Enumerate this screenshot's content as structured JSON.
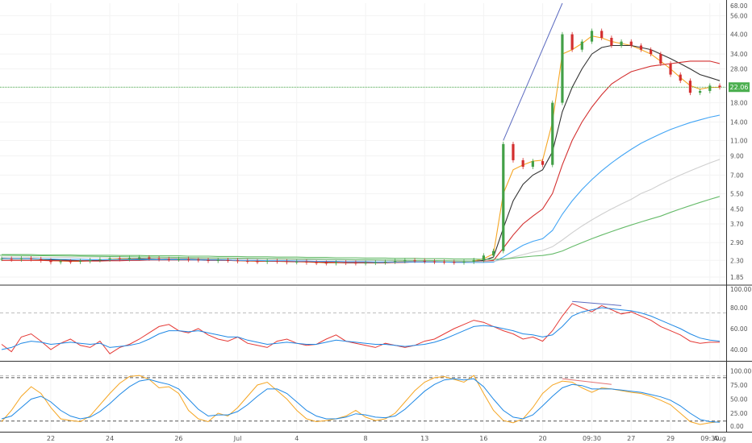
{
  "chart_data": [
    {
      "type": "candlestick",
      "panel": "price",
      "scale": "log",
      "ylim": [
        1.7,
        66
      ],
      "y_ticks": [
        "68.00",
        "56.00",
        "44.00",
        "34.00",
        "28.00",
        "22.00",
        "18.00",
        "14.00",
        "11.00",
        "9.00",
        "7.00",
        "5.50",
        "4.50",
        "3.70",
        "2.90",
        "2.30",
        "1.85"
      ],
      "last_price_label": "22.06",
      "last_price": 22.06,
      "x_ticks": [
        "22",
        "24",
        "26",
        "Jul",
        "4",
        "8",
        "13",
        "16",
        "20",
        "09:30",
        "27",
        "29",
        "09:30",
        "Aug"
      ],
      "closes": [
        2.35,
        2.33,
        2.36,
        2.34,
        2.3,
        2.25,
        2.27,
        2.26,
        2.28,
        2.31,
        2.33,
        2.36,
        2.34,
        2.37,
        2.39,
        2.36,
        2.34,
        2.33,
        2.34,
        2.32,
        2.31,
        2.29,
        2.31,
        2.3,
        2.28,
        2.27,
        2.26,
        2.28,
        2.27,
        2.25,
        2.26,
        2.24,
        2.23,
        2.22,
        2.24,
        2.23,
        2.22,
        2.23,
        2.24,
        2.26,
        2.28,
        2.3,
        2.29,
        2.27,
        2.26,
        2.25,
        2.24,
        2.26,
        2.31,
        2.45,
        2.6,
        10.5,
        8.5,
        7.8,
        8.4,
        8.0,
        18.0,
        44.0,
        36.0,
        40.0,
        46.0,
        42.0,
        38.0,
        40.0,
        38.0,
        36.0,
        34.0,
        30.0,
        26.0,
        24.0,
        20.5,
        21.0,
        22.5,
        22.06
      ],
      "series": [
        {
          "name": "",
          "color": "#f5a623",
          "values": [
            2.35,
            2.34,
            2.34,
            2.34,
            2.32,
            2.29,
            2.28,
            2.27,
            2.27,
            2.29,
            2.31,
            2.33,
            2.34,
            2.35,
            2.37,
            2.36,
            2.35,
            2.34,
            2.34,
            2.33,
            2.32,
            2.31,
            2.31,
            2.3,
            2.29,
            2.28,
            2.27,
            2.27,
            2.27,
            2.26,
            2.26,
            2.25,
            2.24,
            2.23,
            2.23,
            2.23,
            2.23,
            2.23,
            2.23,
            2.24,
            2.26,
            2.28,
            2.28,
            2.28,
            2.27,
            2.26,
            2.25,
            2.26,
            2.28,
            2.35,
            2.5,
            5.5,
            7.5,
            8.0,
            8.4,
            8.5,
            14.0,
            34.0,
            36.0,
            39.0,
            43.0,
            42.0,
            40.0,
            39.0,
            38.0,
            36.0,
            34.0,
            31.0,
            28.0,
            25.0,
            22.5,
            21.5,
            22.0,
            22.0
          ]
        },
        {
          "name": "",
          "color": "#333333",
          "values": [
            2.36,
            2.35,
            2.35,
            2.35,
            2.34,
            2.32,
            2.31,
            2.3,
            2.29,
            2.29,
            2.3,
            2.31,
            2.32,
            2.33,
            2.34,
            2.35,
            2.35,
            2.34,
            2.34,
            2.34,
            2.33,
            2.32,
            2.32,
            2.31,
            2.3,
            2.29,
            2.28,
            2.28,
            2.27,
            2.27,
            2.26,
            2.26,
            2.25,
            2.24,
            2.24,
            2.23,
            2.23,
            2.23,
            2.23,
            2.23,
            2.24,
            2.25,
            2.26,
            2.27,
            2.27,
            2.26,
            2.26,
            2.26,
            2.27,
            2.3,
            2.4,
            3.5,
            5.0,
            6.2,
            7.0,
            7.5,
            9.5,
            16.0,
            22.0,
            28.0,
            34.0,
            37.0,
            38.0,
            38.0,
            38.0,
            37.0,
            36.0,
            34.0,
            32.0,
            30.0,
            28.0,
            26.0,
            25.0,
            24.0
          ]
        },
        {
          "name": "",
          "color": "#d32f2f",
          "values": [
            2.3,
            2.3,
            2.3,
            2.3,
            2.3,
            2.29,
            2.29,
            2.28,
            2.28,
            2.28,
            2.28,
            2.29,
            2.29,
            2.3,
            2.3,
            2.31,
            2.31,
            2.31,
            2.31,
            2.31,
            2.31,
            2.3,
            2.3,
            2.3,
            2.29,
            2.29,
            2.28,
            2.28,
            2.27,
            2.27,
            2.26,
            2.26,
            2.25,
            2.25,
            2.24,
            2.24,
            2.24,
            2.24,
            2.24,
            2.24,
            2.24,
            2.24,
            2.25,
            2.25,
            2.25,
            2.25,
            2.25,
            2.25,
            2.25,
            2.27,
            2.3,
            2.7,
            3.2,
            3.7,
            4.1,
            4.5,
            5.5,
            8.0,
            11.0,
            14.0,
            17.0,
            20.0,
            23.0,
            25.0,
            27.0,
            28.0,
            29.0,
            29.5,
            30.0,
            30.5,
            31.0,
            31.0,
            31.0,
            30.0
          ]
        },
        {
          "name": "",
          "color": "#42a5f5",
          "values": [
            2.35,
            2.35,
            2.35,
            2.34,
            2.34,
            2.34,
            2.33,
            2.33,
            2.33,
            2.32,
            2.32,
            2.32,
            2.32,
            2.32,
            2.32,
            2.32,
            2.32,
            2.32,
            2.32,
            2.32,
            2.31,
            2.31,
            2.31,
            2.31,
            2.3,
            2.3,
            2.3,
            2.29,
            2.29,
            2.29,
            2.28,
            2.28,
            2.27,
            2.27,
            2.27,
            2.26,
            2.26,
            2.26,
            2.25,
            2.25,
            2.25,
            2.25,
            2.25,
            2.25,
            2.25,
            2.25,
            2.24,
            2.24,
            2.24,
            2.24,
            2.25,
            2.4,
            2.6,
            2.8,
            2.95,
            3.05,
            3.4,
            4.2,
            5.0,
            5.8,
            6.6,
            7.4,
            8.2,
            9.0,
            9.8,
            10.6,
            11.3,
            12.0,
            12.7,
            13.3,
            13.9,
            14.4,
            14.9,
            15.3
          ]
        },
        {
          "name": "",
          "color": "#cfcfcf",
          "values": [
            2.4,
            2.4,
            2.4,
            2.4,
            2.39,
            2.39,
            2.39,
            2.39,
            2.38,
            2.38,
            2.38,
            2.38,
            2.37,
            2.37,
            2.37,
            2.37,
            2.36,
            2.36,
            2.36,
            2.36,
            2.35,
            2.35,
            2.35,
            2.35,
            2.34,
            2.34,
            2.34,
            2.33,
            2.33,
            2.33,
            2.32,
            2.32,
            2.32,
            2.31,
            2.31,
            2.31,
            2.3,
            2.3,
            2.3,
            2.29,
            2.29,
            2.29,
            2.28,
            2.28,
            2.28,
            2.27,
            2.27,
            2.27,
            2.26,
            2.26,
            2.27,
            2.32,
            2.4,
            2.48,
            2.56,
            2.62,
            2.75,
            3.0,
            3.3,
            3.6,
            3.9,
            4.2,
            4.5,
            4.8,
            5.1,
            5.5,
            5.8,
            6.2,
            6.6,
            7.0,
            7.4,
            7.8,
            8.2,
            8.6
          ]
        },
        {
          "name": "",
          "color": "#66bb6a",
          "values": [
            2.48,
            2.48,
            2.48,
            2.48,
            2.47,
            2.47,
            2.47,
            2.47,
            2.46,
            2.46,
            2.46,
            2.46,
            2.45,
            2.45,
            2.45,
            2.44,
            2.44,
            2.44,
            2.44,
            2.43,
            2.43,
            2.43,
            2.42,
            2.42,
            2.42,
            2.41,
            2.41,
            2.41,
            2.4,
            2.4,
            2.4,
            2.39,
            2.39,
            2.39,
            2.38,
            2.38,
            2.38,
            2.37,
            2.37,
            2.37,
            2.36,
            2.36,
            2.36,
            2.35,
            2.35,
            2.35,
            2.34,
            2.34,
            2.34,
            2.33,
            2.33,
            2.34,
            2.37,
            2.4,
            2.43,
            2.45,
            2.5,
            2.6,
            2.75,
            2.9,
            3.05,
            3.2,
            3.35,
            3.5,
            3.65,
            3.8,
            3.95,
            4.1,
            4.3,
            4.5,
            4.7,
            4.9,
            5.1,
            5.3
          ]
        }
      ]
    },
    {
      "type": "line",
      "panel": "rsi",
      "ylim": [
        30,
        100
      ],
      "y_ticks": [
        "100.00",
        "80.00",
        "60.00",
        "40.00"
      ],
      "levels": [
        75,
        15
      ],
      "series": [
        {
          "name": "",
          "color": "#e53935",
          "values": [
            45,
            38,
            52,
            55,
            48,
            40,
            46,
            50,
            44,
            42,
            48,
            36,
            42,
            45,
            50,
            56,
            62,
            64,
            58,
            56,
            60,
            54,
            50,
            48,
            52,
            46,
            44,
            42,
            48,
            50,
            46,
            44,
            45,
            50,
            54,
            48,
            46,
            44,
            42,
            46,
            44,
            42,
            44,
            48,
            50,
            55,
            60,
            64,
            68,
            66,
            62,
            58,
            55,
            50,
            52,
            48,
            58,
            72,
            84,
            80,
            76,
            82,
            78,
            74,
            76,
            72,
            68,
            62,
            58,
            54,
            48,
            46,
            47,
            47
          ]
        },
        {
          "name": "",
          "color": "#1e88e5",
          "values": [
            40,
            42,
            46,
            48,
            47,
            45,
            46,
            47,
            46,
            45,
            46,
            42,
            43,
            44,
            46,
            50,
            55,
            58,
            58,
            57,
            58,
            56,
            54,
            52,
            52,
            49,
            47,
            45,
            46,
            47,
            46,
            45,
            45,
            47,
            49,
            48,
            47,
            46,
            45,
            45,
            44,
            43,
            44,
            45,
            47,
            50,
            54,
            58,
            62,
            63,
            62,
            60,
            58,
            55,
            54,
            52,
            54,
            62,
            72,
            76,
            78,
            80,
            79,
            78,
            77,
            75,
            72,
            68,
            64,
            60,
            55,
            51,
            49,
            48
          ]
        }
      ],
      "annotations": [
        "divergence"
      ]
    },
    {
      "type": "line",
      "panel": "stochastic",
      "ylim": [
        -5,
        115
      ],
      "y_ticks": [
        "100.00",
        "75.00",
        "50.00",
        "25.00",
        "0.00"
      ],
      "levels": [
        88,
        11
      ],
      "series": [
        {
          "name": "",
          "color": "#f5a623",
          "values": [
            10,
            30,
            55,
            72,
            60,
            35,
            15,
            12,
            10,
            20,
            40,
            60,
            78,
            90,
            92,
            85,
            70,
            72,
            60,
            30,
            15,
            10,
            25,
            20,
            35,
            55,
            75,
            80,
            65,
            50,
            30,
            15,
            10,
            12,
            15,
            20,
            30,
            18,
            12,
            15,
            25,
            45,
            65,
            80,
            88,
            90,
            85,
            80,
            92,
            60,
            30,
            12,
            8,
            15,
            35,
            60,
            75,
            82,
            80,
            70,
            62,
            70,
            68,
            65,
            62,
            60,
            55,
            48,
            40,
            25,
            10,
            5,
            8,
            10
          ]
        },
        {
          "name": "",
          "color": "#1e88e5",
          "values": [
            15,
            20,
            35,
            50,
            55,
            45,
            30,
            20,
            15,
            18,
            28,
            42,
            58,
            72,
            82,
            85,
            80,
            76,
            68,
            50,
            32,
            20,
            22,
            22,
            28,
            40,
            55,
            68,
            68,
            60,
            45,
            30,
            20,
            15,
            15,
            18,
            24,
            22,
            18,
            17,
            20,
            32,
            48,
            64,
            76,
            84,
            86,
            84,
            86,
            72,
            50,
            30,
            18,
            15,
            22,
            38,
            55,
            70,
            76,
            74,
            68,
            68,
            68,
            66,
            64,
            62,
            58,
            54,
            48,
            38,
            25,
            14,
            10,
            9
          ]
        }
      ],
      "annotations": [
        "divergence"
      ]
    }
  ]
}
